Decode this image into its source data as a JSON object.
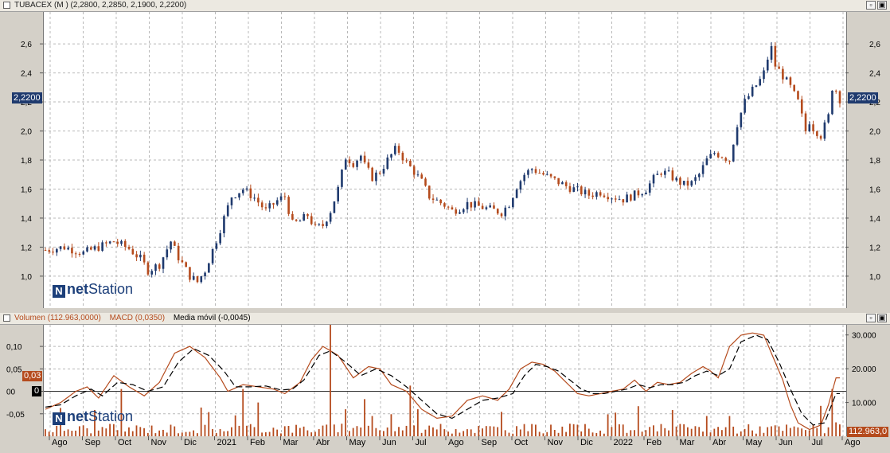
{
  "top_panel": {
    "title": "TUBACEX (M ) (2,2800, 2,2850, 2,1900, 2,2200)",
    "price_tag": "2,2200"
  },
  "bottom_panel": {
    "legend": [
      {
        "label": "Volumen (112.963,0000)",
        "color": "#b54b1d"
      },
      {
        "label": "MACD (0,0350)",
        "color": "#b54b1d"
      },
      {
        "label": "Media móvil (-0,0045)",
        "color": "#000000"
      }
    ],
    "macd_tag": "0,03",
    "zero_tag": "0",
    "volume_tag": "112.963,0"
  },
  "brand": {
    "logo": "N",
    "part1": "net",
    "part2": "Station"
  },
  "window_buttons": {
    "minimize": "▫",
    "maximize": "▣"
  },
  "colors": {
    "up": "#1f3a6e",
    "down": "#b54b1d",
    "grid": "#b8b8b8"
  },
  "chart_data": [
    {
      "type": "candlestick",
      "title": "TUBACEX (M ) (2,2800, 2,2850, 2,1900, 2,2200)",
      "ylim": [
        0.78,
        2.82
      ],
      "y_ticks": [
        1.0,
        1.2,
        1.4,
        1.6,
        1.8,
        2.0,
        2.2,
        2.4,
        2.6
      ],
      "y_tick_labels": [
        "1,0",
        "1,2",
        "1,4",
        "1,6",
        "1,8",
        "2,0",
        "2,2",
        "2,4",
        "2,6"
      ],
      "x_labels": [
        "Ago",
        "Sep",
        "Oct",
        "Nov",
        "Dic",
        "2021",
        "Feb",
        "Mar",
        "Abr",
        "May",
        "Jun",
        "Jul",
        "Ago",
        "Sep",
        "Oct",
        "Nov",
        "Dic",
        "2022",
        "Feb",
        "Mar",
        "Abr",
        "May",
        "Jun",
        "Jul",
        "Ago"
      ],
      "close_path": [
        [
          0,
          1.18
        ],
        [
          5,
          1.2
        ],
        [
          10,
          1.16
        ],
        [
          15,
          1.21
        ],
        [
          18,
          1.24
        ],
        [
          22,
          1.19
        ],
        [
          25,
          1.12
        ],
        [
          27,
          1.04
        ],
        [
          30,
          1.08
        ],
        [
          33,
          1.24
        ],
        [
          35,
          1.13
        ],
        [
          38,
          1.0
        ],
        [
          40,
          0.96
        ],
        [
          42,
          1.04
        ],
        [
          45,
          1.25
        ],
        [
          47,
          1.4
        ],
        [
          49,
          1.55
        ],
        [
          52,
          1.6
        ],
        [
          55,
          1.54
        ],
        [
          58,
          1.45
        ],
        [
          61,
          1.52
        ],
        [
          63,
          1.55
        ],
        [
          65,
          1.36
        ],
        [
          67,
          1.38
        ],
        [
          69,
          1.42
        ],
        [
          71,
          1.33
        ],
        [
          73,
          1.35
        ],
        [
          75,
          1.45
        ],
        [
          77,
          1.6
        ],
        [
          79,
          1.82
        ],
        [
          81,
          1.78
        ],
        [
          83,
          1.83
        ],
        [
          84,
          1.76
        ],
        [
          86,
          1.68
        ],
        [
          88,
          1.72
        ],
        [
          90,
          1.8
        ],
        [
          92,
          1.87
        ],
        [
          93,
          1.86
        ],
        [
          95,
          1.78
        ],
        [
          97,
          1.72
        ],
        [
          99,
          1.65
        ],
        [
          101,
          1.55
        ],
        [
          103,
          1.52
        ],
        [
          105,
          1.49
        ],
        [
          107,
          1.45
        ],
        [
          109,
          1.47
        ],
        [
          111,
          1.5
        ],
        [
          114,
          1.48
        ],
        [
          117,
          1.46
        ],
        [
          120,
          1.44
        ],
        [
          122,
          1.5
        ],
        [
          124,
          1.62
        ],
        [
          126,
          1.7
        ],
        [
          128,
          1.74
        ],
        [
          131,
          1.7
        ],
        [
          134,
          1.66
        ],
        [
          137,
          1.62
        ],
        [
          140,
          1.59
        ],
        [
          143,
          1.56
        ],
        [
          146,
          1.58
        ],
        [
          149,
          1.55
        ],
        [
          152,
          1.53
        ],
        [
          155,
          1.56
        ],
        [
          158,
          1.6
        ],
        [
          160,
          1.67
        ],
        [
          162,
          1.72
        ],
        [
          164,
          1.7
        ],
        [
          166,
          1.66
        ],
        [
          168,
          1.63
        ],
        [
          170,
          1.64
        ],
        [
          172,
          1.7
        ],
        [
          174,
          1.8
        ],
        [
          176,
          1.85
        ],
        [
          178,
          1.83
        ],
        [
          180,
          1.8
        ],
        [
          182,
          2.05
        ],
        [
          184,
          2.2
        ],
        [
          186,
          2.28
        ],
        [
          188,
          2.35
        ],
        [
          189,
          2.4
        ],
        [
          190,
          2.5
        ],
        [
          191,
          2.57
        ],
        [
          192,
          2.45
        ],
        [
          194,
          2.38
        ],
        [
          196,
          2.3
        ],
        [
          198,
          2.2
        ],
        [
          199,
          2.1
        ],
        [
          200,
          2.0
        ],
        [
          201,
          2.07
        ],
        [
          202,
          2.02
        ],
        [
          204,
          1.97
        ],
        [
          206,
          2.1
        ],
        [
          207,
          2.3
        ],
        [
          208,
          2.28
        ],
        [
          209,
          2.22
        ]
      ]
    },
    {
      "type": "line",
      "series": [
        {
          "name": "MACD (0,0350)",
          "color": "#b54b1d",
          "values": [
            [
              0,
              -0.04
            ],
            [
              4,
              -0.025
            ],
            [
              8,
              0.0
            ],
            [
              11,
              0.01
            ],
            [
              14,
              -0.015
            ],
            [
              18,
              0.035
            ],
            [
              22,
              0.01
            ],
            [
              26,
              -0.01
            ],
            [
              30,
              0.02
            ],
            [
              34,
              0.085
            ],
            [
              38,
              0.1
            ],
            [
              42,
              0.075
            ],
            [
              46,
              0.03
            ],
            [
              48,
              0.0
            ],
            [
              52,
              0.015
            ],
            [
              56,
              0.01
            ],
            [
              60,
              0.005
            ],
            [
              63,
              -0.005
            ],
            [
              67,
              0.02
            ],
            [
              70,
              0.07
            ],
            [
              73,
              0.1
            ],
            [
              77,
              0.08
            ],
            [
              81,
              0.03
            ],
            [
              85,
              0.055
            ],
            [
              88,
              0.05
            ],
            [
              91,
              0.015
            ],
            [
              95,
              0.0
            ],
            [
              99,
              -0.04
            ],
            [
              103,
              -0.06
            ],
            [
              107,
              -0.055
            ],
            [
              111,
              -0.02
            ],
            [
              115,
              -0.01
            ],
            [
              119,
              -0.02
            ],
            [
              122,
              0.005
            ],
            [
              125,
              0.05
            ],
            [
              128,
              0.065
            ],
            [
              131,
              0.06
            ],
            [
              134,
              0.045
            ],
            [
              137,
              0.02
            ],
            [
              140,
              -0.005
            ],
            [
              143,
              -0.01
            ],
            [
              146,
              -0.005
            ],
            [
              149,
              0.0
            ],
            [
              152,
              0.005
            ],
            [
              155,
              0.025
            ],
            [
              158,
              0.0
            ],
            [
              161,
              0.02
            ],
            [
              164,
              0.015
            ],
            [
              167,
              0.02
            ],
            [
              170,
              0.04
            ],
            [
              173,
              0.055
            ],
            [
              175,
              0.045
            ],
            [
              177,
              0.03
            ],
            [
              180,
              0.1
            ],
            [
              183,
              0.125
            ],
            [
              186,
              0.13
            ],
            [
              189,
              0.125
            ],
            [
              191,
              0.085
            ],
            [
              194,
              0.025
            ],
            [
              196,
              -0.03
            ],
            [
              198,
              -0.07
            ],
            [
              201,
              -0.085
            ],
            [
              204,
              -0.075
            ],
            [
              206,
              -0.03
            ],
            [
              208,
              0.03
            ]
          ]
        },
        {
          "name": "Media móvil (-0,0045)",
          "color": "#000000",
          "values": [
            [
              0,
              -0.035
            ],
            [
              4,
              -0.03
            ],
            [
              8,
              -0.01
            ],
            [
              12,
              0.005
            ],
            [
              15,
              -0.01
            ],
            [
              19,
              0.02
            ],
            [
              23,
              0.015
            ],
            [
              27,
              0.0
            ],
            [
              31,
              0.01
            ],
            [
              35,
              0.065
            ],
            [
              39,
              0.095
            ],
            [
              43,
              0.08
            ],
            [
              47,
              0.045
            ],
            [
              50,
              0.01
            ],
            [
              54,
              0.01
            ],
            [
              58,
              0.012
            ],
            [
              62,
              0.003
            ],
            [
              65,
              0.005
            ],
            [
              68,
              0.025
            ],
            [
              72,
              0.08
            ],
            [
              75,
              0.09
            ],
            [
              79,
              0.065
            ],
            [
              83,
              0.035
            ],
            [
              87,
              0.05
            ],
            [
              91,
              0.035
            ],
            [
              95,
              0.01
            ],
            [
              99,
              -0.02
            ],
            [
              103,
              -0.05
            ],
            [
              107,
              -0.06
            ],
            [
              111,
              -0.04
            ],
            [
              115,
              -0.02
            ],
            [
              119,
              -0.015
            ],
            [
              123,
              -0.005
            ],
            [
              126,
              0.035
            ],
            [
              129,
              0.06
            ],
            [
              132,
              0.055
            ],
            [
              135,
              0.045
            ],
            [
              138,
              0.025
            ],
            [
              141,
              0.005
            ],
            [
              144,
              -0.005
            ],
            [
              147,
              -0.005
            ],
            [
              150,
              0.0
            ],
            [
              153,
              0.005
            ],
            [
              156,
              0.015
            ],
            [
              159,
              0.008
            ],
            [
              162,
              0.015
            ],
            [
              165,
              0.015
            ],
            [
              168,
              0.02
            ],
            [
              171,
              0.035
            ],
            [
              174,
              0.045
            ],
            [
              177,
              0.035
            ],
            [
              180,
              0.05
            ],
            [
              183,
              0.11
            ],
            [
              187,
              0.125
            ],
            [
              190,
              0.115
            ],
            [
              193,
              0.065
            ],
            [
              196,
              0.005
            ],
            [
              199,
              -0.05
            ],
            [
              202,
              -0.075
            ],
            [
              205,
              -0.07
            ],
            [
              208,
              -0.005
            ]
          ]
        }
      ],
      "left_ticks": [
        0.1,
        0.05,
        0.0,
        -0.05
      ],
      "left_tick_labels": [
        "0,10",
        "0,05",
        "00",
        "-0,05"
      ],
      "ylim": [
        -0.1,
        0.148
      ]
    },
    {
      "type": "bar",
      "name": "Volumen (112.963,0000)",
      "right_ticks": [
        30000,
        20000,
        10000
      ],
      "right_tick_labels": [
        "30.000",
        "20.000",
        "10.000"
      ],
      "ylim": [
        0,
        33000
      ],
      "spikes": [
        [
          20,
          14000
        ],
        [
          52,
          14000
        ],
        [
          56,
          10000
        ],
        [
          75,
          33000
        ],
        [
          79,
          8000
        ],
        [
          84,
          11000
        ],
        [
          86,
          6000
        ],
        [
          96,
          15000
        ],
        [
          98,
          8000
        ],
        [
          150,
          7000
        ],
        [
          180,
          6000
        ],
        [
          204,
          9000
        ],
        [
          207,
          14000
        ]
      ],
      "typical": 2500
    }
  ]
}
